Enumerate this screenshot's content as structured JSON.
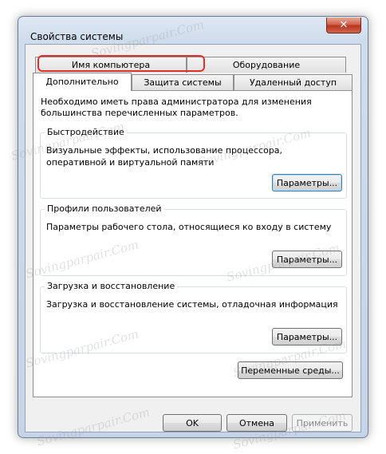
{
  "window": {
    "title": "Свойства системы",
    "close_label": "✕"
  },
  "tabs_top": [
    {
      "label": "Имя компьютера"
    },
    {
      "label": "Оборудование"
    }
  ],
  "tabs_bottom": [
    {
      "label": "Дополнительно",
      "active": true
    },
    {
      "label": "Защита системы"
    },
    {
      "label": "Удаленный доступ"
    }
  ],
  "panel": {
    "intro": "Необходимо иметь права администратора для изменения большинства перечисленных параметров.",
    "groups": [
      {
        "title": "Быстродействие",
        "description": "Визуальные эффекты, использование процессора, оперативной и виртуальной памяти",
        "button": "Параметры..."
      },
      {
        "title": "Профили пользователей",
        "description": "Параметры рабочего стола, относящиеся ко входу в систему",
        "button": "Параметры..."
      },
      {
        "title": "Загрузка и восстановление",
        "description": "Загрузка и восстановление системы, отладочная информация",
        "button": "Параметры..."
      }
    ],
    "env_button": "Переменные среды..."
  },
  "footer": {
    "ok": "OK",
    "cancel": "Отмена",
    "apply": "Применить"
  },
  "watermark": "Sovingparpair.Com",
  "colors": {
    "highlight": "#e0302c",
    "close_button": "#c74531",
    "client_bg": "#f0f0f0"
  }
}
